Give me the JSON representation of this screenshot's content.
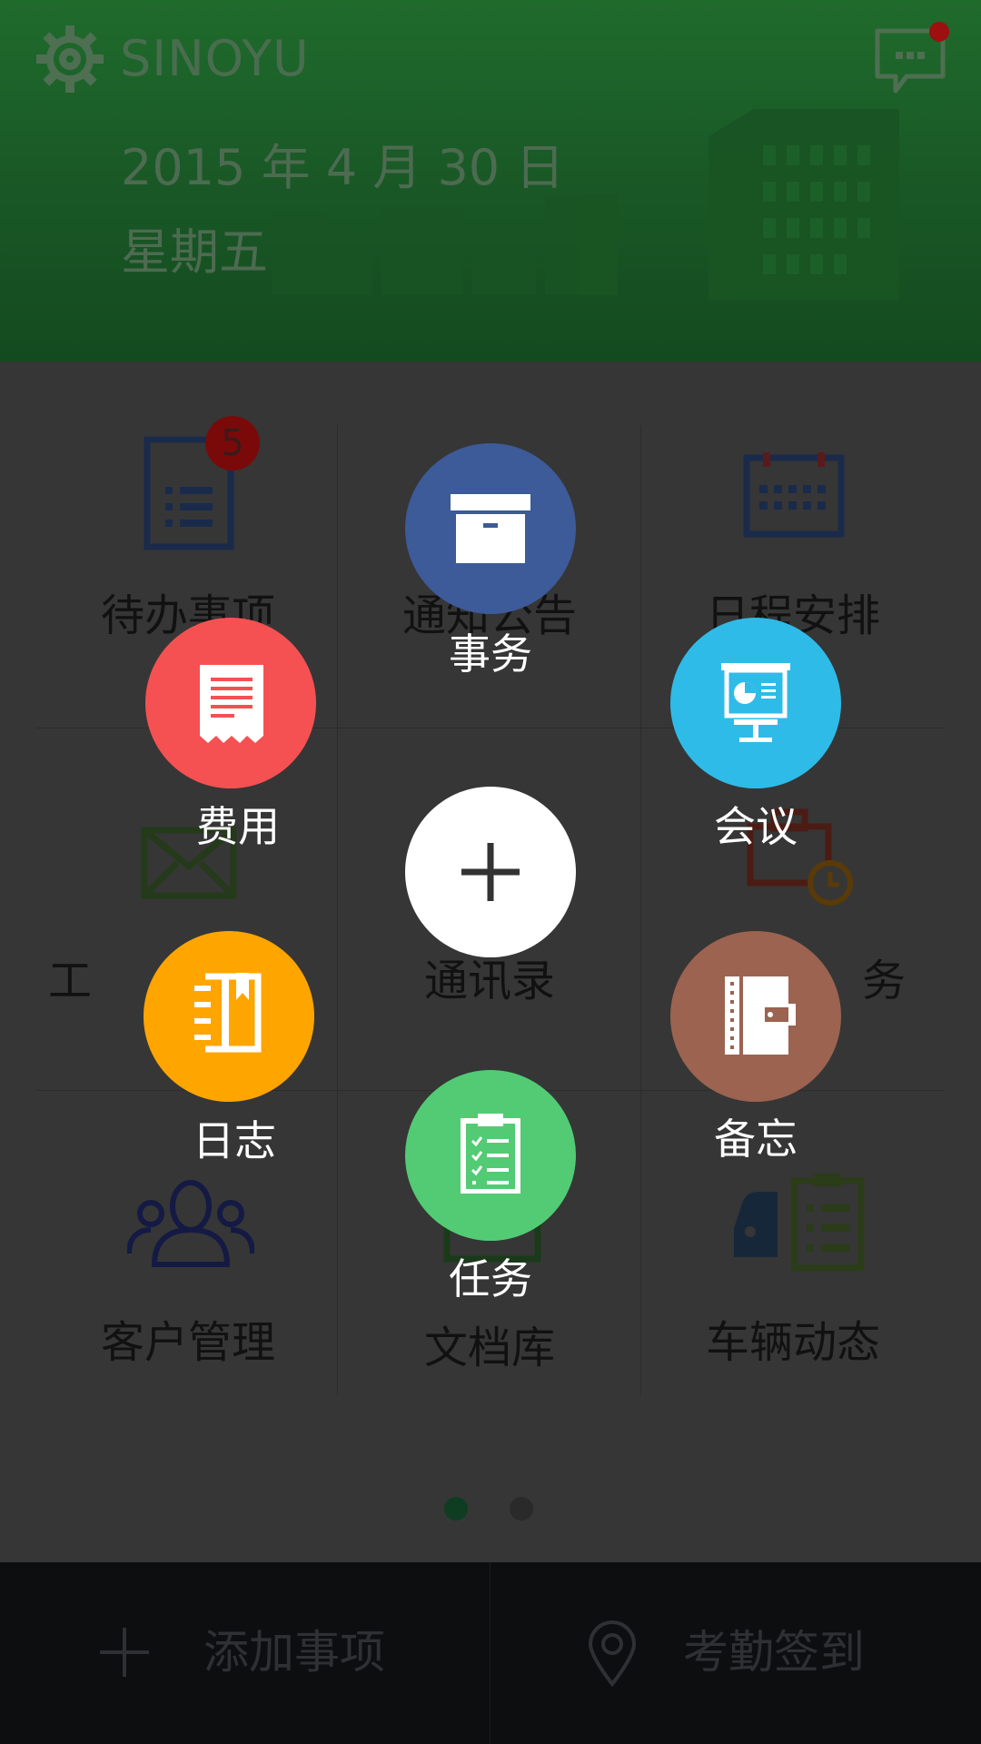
{
  "header": {
    "brand": "SINOYU",
    "date": "2015 年 4 月 30 日",
    "weekday": "星期五"
  },
  "grid": {
    "items": [
      {
        "label": "待办事项",
        "icon": "document-list-icon"
      },
      {
        "label": "通知公告",
        "icon": "announcement-icon"
      },
      {
        "label": "日程安排",
        "icon": "calendar-icon"
      },
      {
        "label": "工作邮件",
        "icon": "mail-icon"
      },
      {
        "label": "通讯录",
        "icon": "contacts-icon"
      },
      {
        "label": "外勤任务",
        "icon": "briefcase-clock-icon"
      },
      {
        "label": "客户管理",
        "icon": "customers-icon"
      },
      {
        "label": "文档库",
        "icon": "document-library-icon"
      },
      {
        "label": "车辆动态",
        "icon": "vehicle-icon"
      }
    ],
    "visible_labels": {
      "todo_part": "待办事项",
      "notice_part": "通知公告",
      "schedule_part": "日程安排",
      "mail_part": "工",
      "contacts": "通讯录",
      "field_part": "务",
      "customers": "客户管理",
      "docs": "文档库",
      "vehicles": "车辆动态"
    },
    "todo_badge": "5"
  },
  "pager": {
    "pages": 2,
    "current": 1
  },
  "fan_menu": {
    "center_icon": "plus-icon",
    "items": [
      {
        "key": "affairs",
        "label": "事务",
        "icon": "archive-box-icon",
        "color": "#3d5a99"
      },
      {
        "key": "expense",
        "label": "费用",
        "icon": "receipt-icon",
        "color": "#f55152"
      },
      {
        "key": "meeting",
        "label": "会议",
        "icon": "presentation-board-icon",
        "color": "#2fbbe8"
      },
      {
        "key": "log",
        "label": "日志",
        "icon": "notebook-icon",
        "color": "#ffa500"
      },
      {
        "key": "memo",
        "label": "备忘",
        "icon": "wallet-notebook-icon",
        "color": "#9b6350"
      },
      {
        "key": "task",
        "label": "任务",
        "icon": "clipboard-checklist-icon",
        "color": "#52cb74"
      }
    ]
  },
  "bottombar": {
    "add_label": "添加事项",
    "checkin_label": "考勤签到"
  },
  "colors": {
    "header_green": "#1f6b2c",
    "overlay_gray": "#363636",
    "pager_active": "#0f3d22",
    "pager_inactive": "#2a2a2a"
  }
}
